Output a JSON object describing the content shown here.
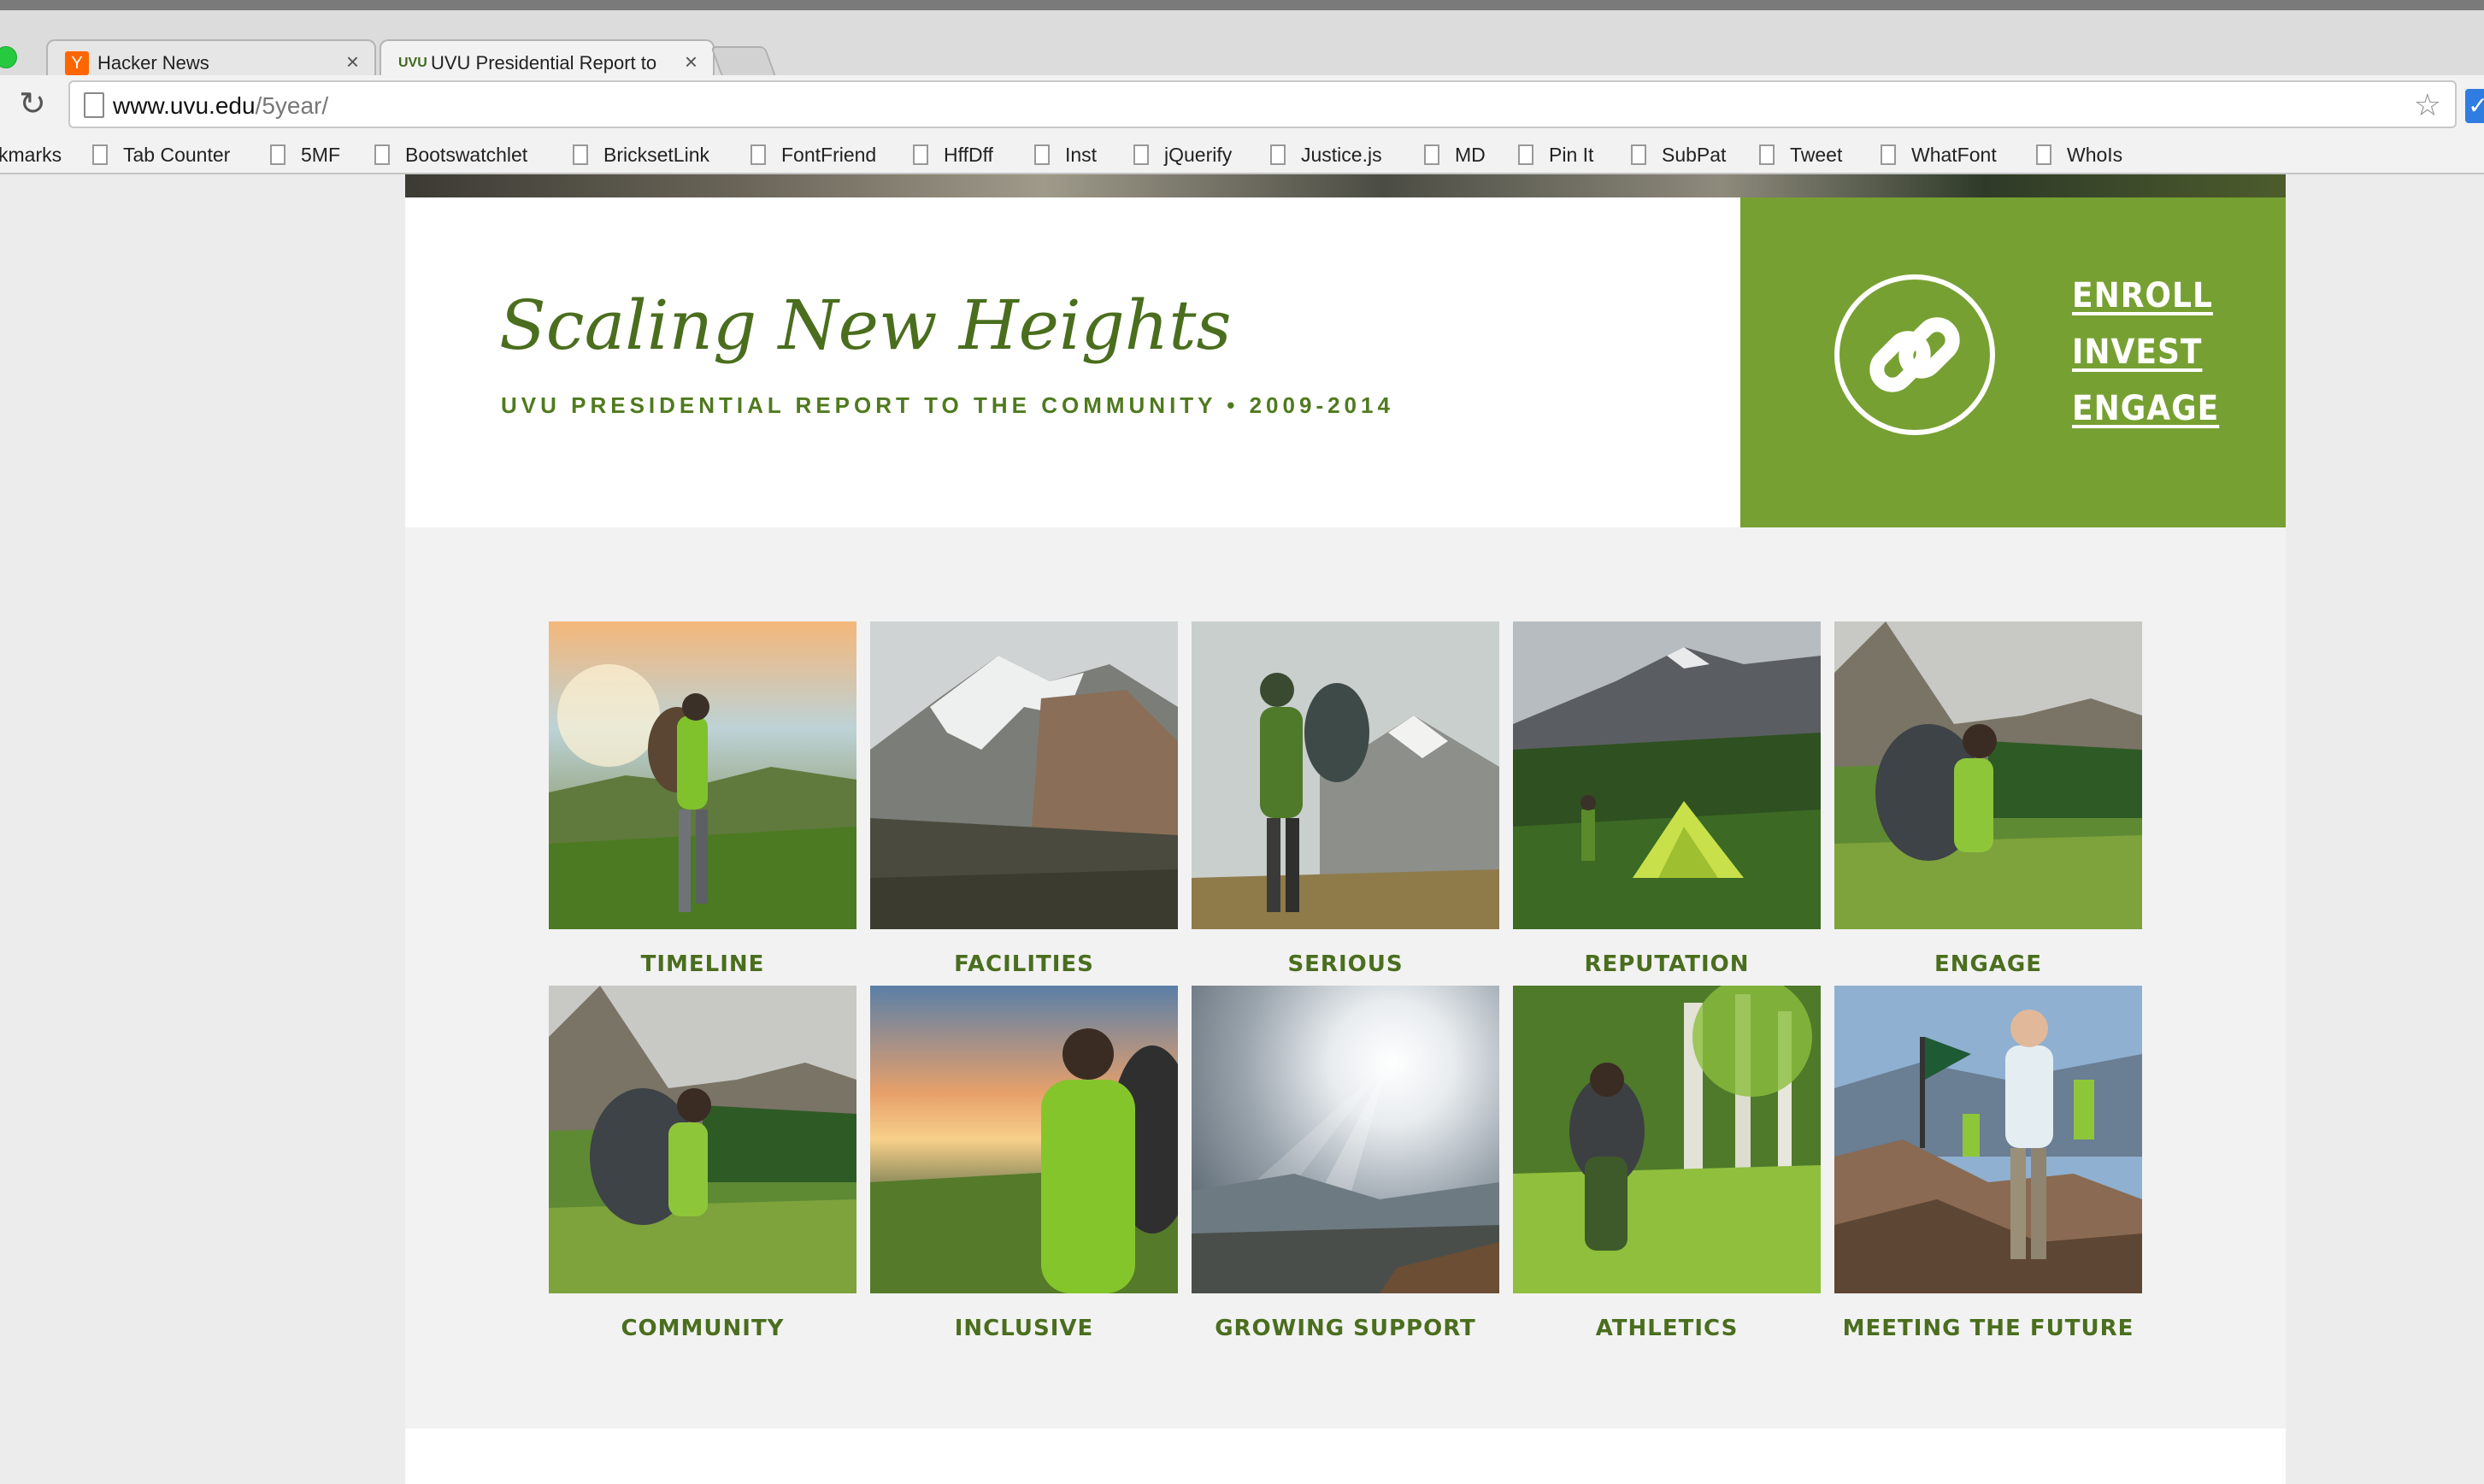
{
  "browser": {
    "tabs": [
      {
        "favicon": "Y",
        "title": "Hacker News",
        "close": "×"
      },
      {
        "favicon": "UVU",
        "title": "UVU Presidential Report to",
        "close": "×"
      }
    ],
    "url": {
      "host": "www.uvu.edu",
      "path": "/5year/"
    },
    "reload_icon": "↻",
    "bookmark_star_icon": "☆",
    "extension_icon": "✓",
    "bookmarks": [
      "kmarks",
      "Tab Counter",
      "5MF",
      "Bootswatchlet",
      "BricksetLink",
      "FontFriend",
      "HffDff",
      "Inst",
      "jQuerify",
      "Justice.js",
      "MD",
      "Pin It",
      "SubPat",
      "Tweet",
      "WhatFont",
      "WhoIs"
    ]
  },
  "hero": {
    "title": "Scaling New Heights",
    "subtitle": "UVU PRESIDENTIAL REPORT TO THE COMMUNITY • 2009-2014"
  },
  "cta": {
    "icon": "link-icon",
    "links": [
      "ENROLL",
      "INVEST",
      "ENGAGE"
    ],
    "background_color": "#77a032"
  },
  "sections": [
    {
      "label": "TIMELINE",
      "scene": "hiker-sunrise"
    },
    {
      "label": "FACILITIES",
      "scene": "snowy-peak"
    },
    {
      "label": "SERIOUS",
      "scene": "hiker-mountain"
    },
    {
      "label": "REPUTATION",
      "scene": "tent-valley"
    },
    {
      "label": "ENGAGE",
      "scene": "hiker-meadow"
    },
    {
      "label": "COMMUNITY",
      "scene": "hiker-meadow"
    },
    {
      "label": "INCLUSIVE",
      "scene": "hiker-sunset"
    },
    {
      "label": "GROWING SUPPORT",
      "scene": "sunrays-valley"
    },
    {
      "label": "ATHLETICS",
      "scene": "hiker-forest"
    },
    {
      "label": "MEETING THE FUTURE",
      "scene": "group-summit"
    }
  ],
  "colors": {
    "brand_green": "#4a6e1e",
    "accent_green": "#77a032",
    "section_bg": "#f2f2f2"
  }
}
